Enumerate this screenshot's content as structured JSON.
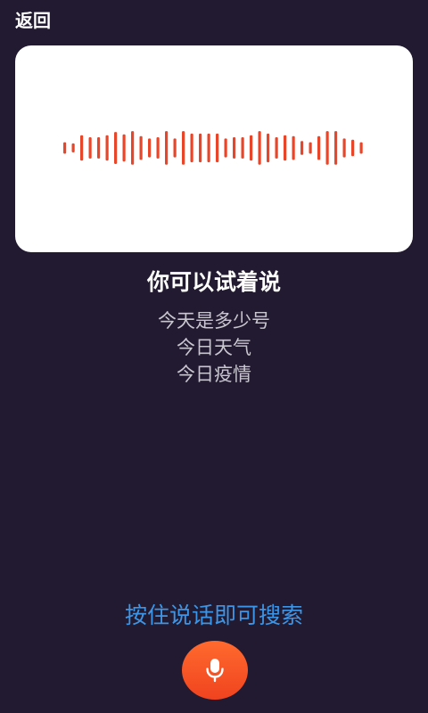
{
  "header": {
    "back_label": "返回"
  },
  "waveform": {
    "bar_color": "#e8462a",
    "levels": [
      0.28,
      0.22,
      0.62,
      0.52,
      0.52,
      0.62,
      0.78,
      0.66,
      0.82,
      0.58,
      0.46,
      0.52,
      0.82,
      0.46,
      0.82,
      0.7,
      0.7,
      0.7,
      0.7,
      0.46,
      0.52,
      0.52,
      0.62,
      0.82,
      0.7,
      0.52,
      0.62,
      0.58,
      0.34,
      0.28,
      0.58,
      0.82,
      0.82,
      0.46,
      0.4,
      0.28
    ]
  },
  "suggestions": {
    "title": "你可以试着说",
    "items": [
      "今天是多少号",
      "今日天气",
      "今日疫情"
    ]
  },
  "voice": {
    "hint": "按住说话即可搜索",
    "mic_icon": "microphone-icon"
  },
  "colors": {
    "background": "#221a30",
    "card": "#ffffff",
    "accent_blue": "#3c95e6",
    "mic_orange": "#f5552a"
  }
}
